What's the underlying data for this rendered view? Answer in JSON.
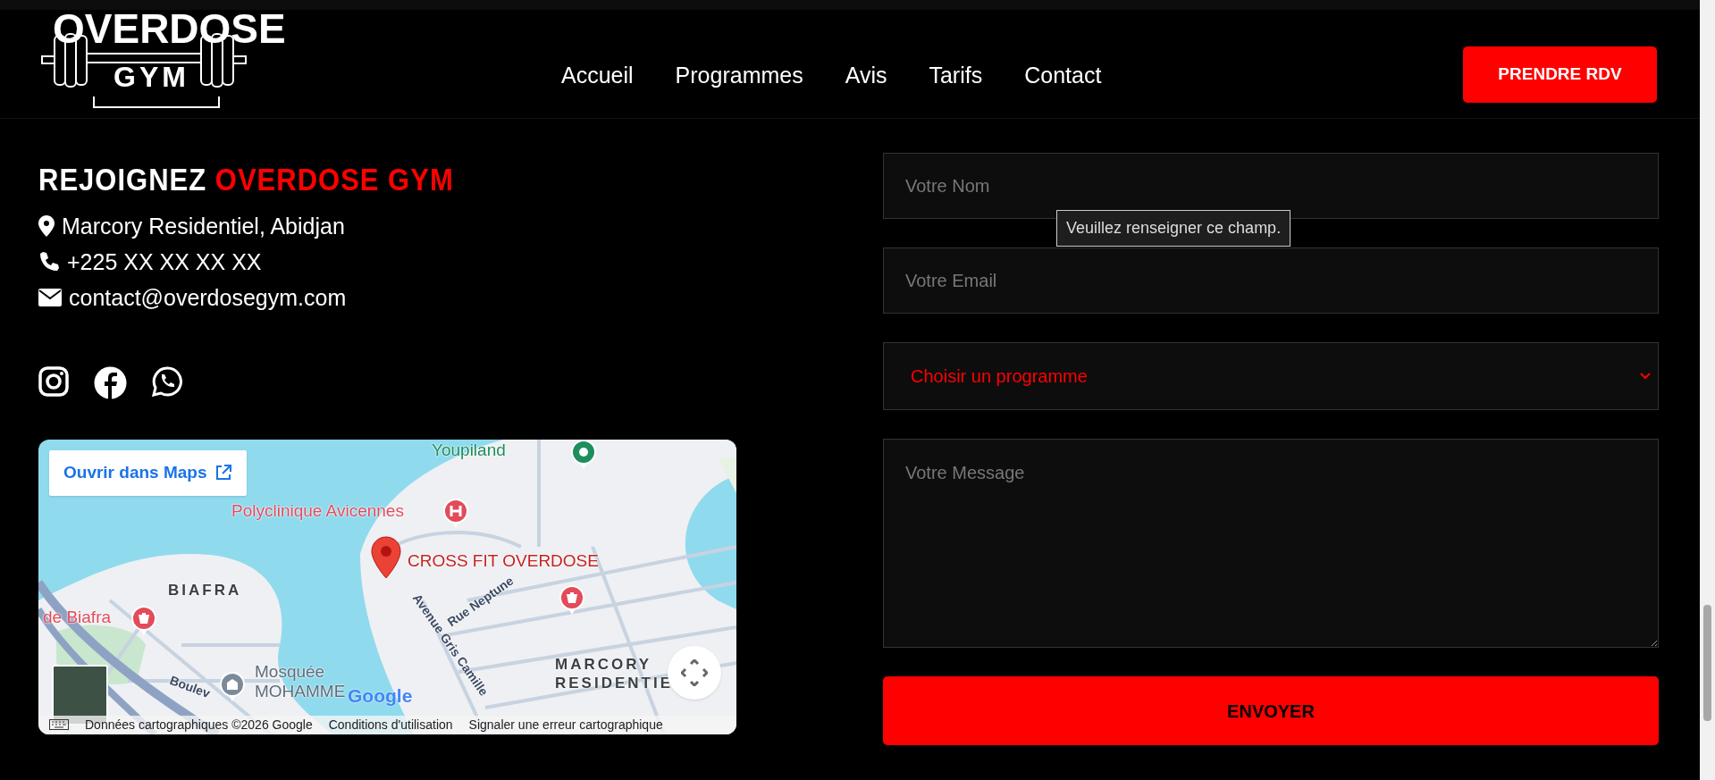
{
  "header": {
    "logo": {
      "top": "OVERDOSE",
      "bottom": "GYM"
    },
    "nav": [
      {
        "label": "Accueil"
      },
      {
        "label": "Programmes"
      },
      {
        "label": "Avis"
      },
      {
        "label": "Tarifs"
      },
      {
        "label": "Contact"
      }
    ],
    "cta": "PRENDRE RDV"
  },
  "contact": {
    "heading": {
      "plain": "REJOIGNEZ",
      "accent": "OVERDOSE GYM"
    },
    "lines": [
      {
        "kind": "address",
        "text": "Marcory Residentiel, Abidjan"
      },
      {
        "kind": "phone",
        "text": "+225 XX XX XX XX"
      },
      {
        "kind": "email",
        "text": "contact@overdosegym.com"
      }
    ],
    "socials": [
      {
        "kind": "instagram"
      },
      {
        "kind": "facebook"
      },
      {
        "kind": "whatsapp"
      }
    ]
  },
  "map": {
    "open_link": "Ouvrir dans Maps",
    "labels": [
      {
        "kind": "poi",
        "text": "Youpiland",
        "color": "#1e8e5e"
      },
      {
        "kind": "poi",
        "text": "Polyclinique Avicennes",
        "color": "#e34b5a"
      },
      {
        "kind": "poi",
        "text": "CROSS FIT OVERDOSE",
        "color": "#c5221f"
      },
      {
        "kind": "area",
        "text": "BIAFRA",
        "color": "#3c4043"
      },
      {
        "kind": "poi",
        "text": "de Biafra",
        "color": "#e34b5a"
      },
      {
        "kind": "poi",
        "text": "Mosquée",
        "color": "#5f6b78"
      },
      {
        "kind": "poi",
        "text": "MOHAMME",
        "color": "#5f6b78"
      },
      {
        "kind": "area",
        "text": "MARCORY",
        "color": "#3c4043"
      },
      {
        "kind": "area",
        "text": "RESIDENTIE",
        "color": "#3c4043"
      },
      {
        "kind": "street",
        "text": "Avenue Gris Camille",
        "color": "#3c4a63"
      },
      {
        "kind": "street",
        "text": "Rue Neptune",
        "color": "#3c4a63"
      },
      {
        "kind": "street",
        "text": "Boulev",
        "color": "#3c4a63"
      }
    ],
    "pins": [
      {
        "kind": "park"
      },
      {
        "kind": "hospital"
      },
      {
        "kind": "pharmacy"
      },
      {
        "kind": "pharmacy"
      },
      {
        "kind": "mosque"
      },
      {
        "kind": "place"
      }
    ],
    "google": "Google",
    "attribution": [
      "Données cartographiques ©2026 Google",
      "Conditions d'utilisation",
      "Signaler une erreur cartographique"
    ]
  },
  "form": {
    "fields": [
      {
        "kind": "input",
        "placeholder": "Votre Nom"
      },
      {
        "kind": "input",
        "placeholder": "Votre Email"
      },
      {
        "kind": "select",
        "value": "Choisir un programme"
      },
      {
        "kind": "textarea",
        "placeholder": "Votre Message"
      }
    ],
    "tooltip": "Veuillez renseigner ce champ.",
    "submit": "ENVOYER"
  }
}
